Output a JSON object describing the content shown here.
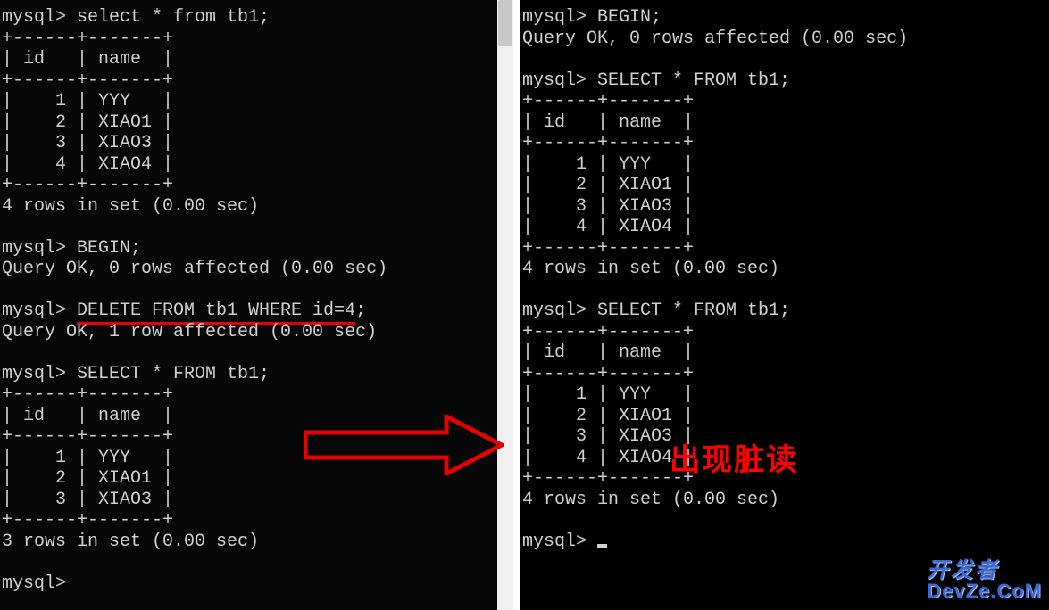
{
  "left": {
    "l1": "mysql> select * from tb1;",
    "l2": "+------+-------+",
    "l3": "| id   | name  |",
    "l4": "+------+-------+",
    "l5": "|    1 | YYY   |",
    "l6": "|    2 | XIAO1 |",
    "l7": "|    3 | XIAO3 |",
    "l8": "|    4 | XIAO4 |",
    "l9": "+------+-------+",
    "l10": "4 rows in set (0.00 sec)",
    "l11": "",
    "l12": "mysql> BEGIN;",
    "l13": "Query OK, 0 rows affected (0.00 sec)",
    "l14": "",
    "l15a": "mysql> ",
    "l15b": "DELETE FROM tb1 WHERE id=4",
    "l15c": ";",
    "l16": "Query OK, 1 row affected (0.00 sec)",
    "l17": "",
    "l18": "mysql> SELECT * FROM tb1;",
    "l19": "+------+-------+",
    "l20": "| id   | name  |",
    "l21": "+------+-------+",
    "l22": "|    1 | YYY   |",
    "l23": "|    2 | XIAO1 |",
    "l24": "|    3 | XIAO3 |",
    "l25": "+------+-------+",
    "l26": "3 rows in set (0.00 sec)",
    "l27": "",
    "l28": "mysql> "
  },
  "right": {
    "l1": "mysql> BEGIN;",
    "l2": "Query OK, 0 rows affected (0.00 sec)",
    "l3": "",
    "l4": "mysql> SELECT * FROM tb1;",
    "l5": "+------+-------+",
    "l6": "| id   | name  |",
    "l7": "+------+-------+",
    "l8": "|    1 | YYY   |",
    "l9": "|    2 | XIAO1 |",
    "l10": "|    3 | XIAO3 |",
    "l11": "|    4 | XIAO4 |",
    "l12": "+------+-------+",
    "l13": "4 rows in set (0.00 sec)",
    "l14": "",
    "l15": "mysql> SELECT * FROM tb1;",
    "l16": "+------+-------+",
    "l17": "| id   | name  |",
    "l18": "+------+-------+",
    "l19": "|    1 | YYY   |",
    "l20": "|    2 | XIAO1 |",
    "l21": "|    3 | XIAO3 |",
    "l22": "|    4 | XIAO4 |",
    "l23": "+------+-------+",
    "l24": "4 rows in set (0.00 sec)",
    "l25": "",
    "l26": "mysql> "
  },
  "annotation": "出现脏读",
  "watermark": {
    "top": "开发者",
    "bot": "DevZe.CoM"
  },
  "colors": {
    "red": "#ff0000",
    "blue": "#3a68d4"
  }
}
